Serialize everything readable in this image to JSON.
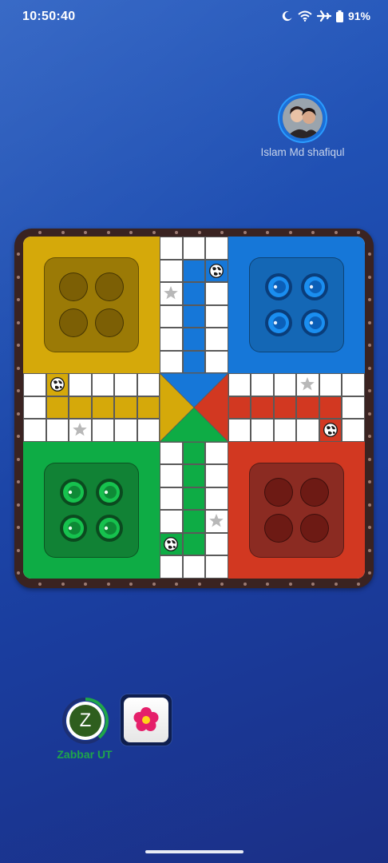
{
  "status_bar": {
    "time": "10:50:40",
    "battery": "91%",
    "icons": [
      "moon-icon",
      "wifi-icon",
      "airplane-icon",
      "battery-icon"
    ]
  },
  "opponent": {
    "name": "Islam Md shafiqul",
    "ring_color": "#2a9cff"
  },
  "board": {
    "colors": {
      "yellow": "#d5a90a",
      "yellow_yard": "#9b7a06",
      "blue": "#1677d8",
      "blue_yard": "#1467b5",
      "green": "#0eac45",
      "green_yard": "#118235",
      "red": "#d23821",
      "red_yard": "#8b2b22"
    },
    "tokens": {
      "yellow": "inactive",
      "blue": "active",
      "green": "active",
      "red": "inactive"
    }
  },
  "player": {
    "name": "Zabbar UT",
    "initial": "Z",
    "timer_color": "#1fa64a"
  },
  "dice": {
    "icon": "flower-icon"
  }
}
